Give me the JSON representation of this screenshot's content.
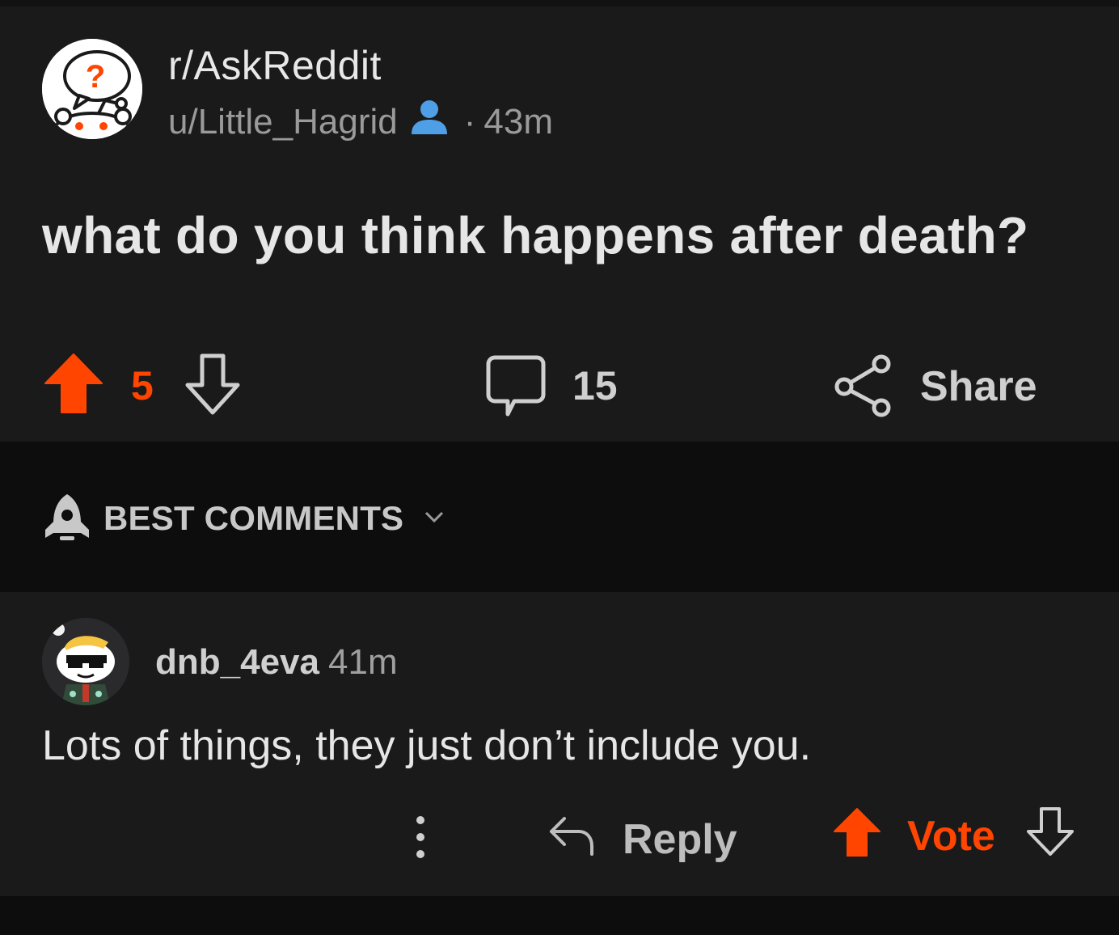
{
  "post": {
    "subreddit": "r/AskReddit",
    "author": "u/Little_Hagrid",
    "separator": "·",
    "age": "43m",
    "title": "what do you think happens after death?",
    "score": "5",
    "comment_count": "15",
    "share_label": "Share",
    "icons": {
      "subreddit_avatar": "askreddit-snoo-icon",
      "author_badge": "user-icon",
      "upvote": "upvote-arrow-icon",
      "downvote": "downvote-arrow-icon",
      "comments": "comment-bubble-icon",
      "share": "share-icon"
    }
  },
  "sort": {
    "label": "BEST COMMENTS",
    "icons": {
      "sort": "rocket-icon",
      "dropdown": "chevron-down-icon"
    }
  },
  "comment": {
    "author": "dnb_4eva",
    "age": "41m",
    "body": "Lots of things, they just don’t include you.",
    "reply_label": "Reply",
    "vote_label": "Vote",
    "icons": {
      "avatar": "user-avatar-snoo",
      "more": "more-options-icon",
      "reply": "reply-arrow-icon",
      "upvote": "upvote-arrow-icon",
      "downvote": "downvote-arrow-icon"
    }
  },
  "colors": {
    "background": "#1a1a1b",
    "divider": "#0d0d0e",
    "accent": "#ff4500",
    "user_badge": "#4f9fe6",
    "text": "#e6e6e6",
    "muted": "#9a9a9a"
  }
}
